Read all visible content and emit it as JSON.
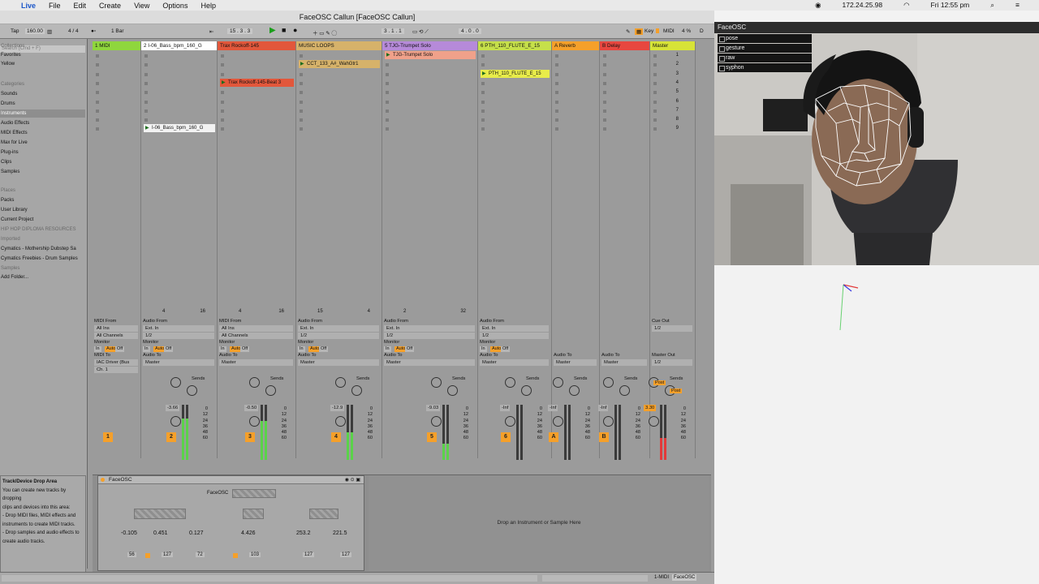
{
  "menubar": {
    "items": [
      "Live",
      "File",
      "Edit",
      "Create",
      "View",
      "Options",
      "Help"
    ],
    "ip": "172.24.25.98",
    "clock": "Fri 12:55 pm"
  },
  "live": {
    "title": "FaceOSC Callun  [FaceOSC Callun]",
    "transport": {
      "tap": "Tap",
      "tempo": "160.00",
      "sig": "4 / 4",
      "quant": "1 Bar",
      "pos": "15 .  3 .  3",
      "loop_start": "3 .  1 .  1",
      "loop_len": "4 .  0 .  0",
      "key": "Key",
      "midi": "MIDI",
      "cpu": "4 %",
      "d": "D"
    },
    "browser": {
      "search": "Search (Cmd + F)",
      "items": [
        {
          "label": "Collections",
          "hdr": true
        },
        {
          "label": "Favorites"
        },
        {
          "label": "Yellow"
        },
        {
          "label": "Categories",
          "hdr": true
        },
        {
          "label": "Sounds"
        },
        {
          "label": "Drums"
        },
        {
          "label": "Instruments",
          "sel": true
        },
        {
          "label": "Audio Effects"
        },
        {
          "label": "MIDI Effects"
        },
        {
          "label": "Max for Live"
        },
        {
          "label": "Plug-ins"
        },
        {
          "label": "Clips"
        },
        {
          "label": "Samples"
        },
        {
          "label": "Places",
          "hdr": true
        },
        {
          "label": "Packs"
        },
        {
          "label": "User Library"
        },
        {
          "label": "Current Project"
        },
        {
          "label": "HIP HOP DIPLOMA RESOURCES",
          "hdr": true
        },
        {
          "label": "Imported",
          "hdr": true
        },
        {
          "label": "Cymatics - Mothership Dubstep Sa"
        },
        {
          "label": "Cymatics Freebies - Drum Samples"
        },
        {
          "label": "Samples",
          "hdr": true
        },
        {
          "label": "Add Folder..."
        }
      ],
      "help_title": "Track/Device Drop Area",
      "help_lines": [
        "You can create new tracks by dropping",
        "clips and devices into this area:",
        "- Drop MIDI files, MIDI effects and",
        "instruments to create MIDI tracks.",
        "- Drop samples and audio effects to",
        "create audio tracks."
      ]
    },
    "tracks": [
      {
        "name": "1 MIDI",
        "color": "#8fd63d",
        "num": "1",
        "from": "MIDI From",
        "fromval": "All Ins",
        "ch": "All Channels",
        "to": "MIDI To",
        "toval": "IAC Driver (Bus",
        "toch": "Ch. 1",
        "vol": "",
        "meter": 0
      },
      {
        "name": "2 I-06_Bass_bpm_160_G",
        "color": "#ffffff",
        "num": "2",
        "from": "Audio From",
        "fromval": "Ext. In",
        "ch": "1/2",
        "to": "Audio To",
        "toval": "Master",
        "toch": "",
        "vol": "-3.66",
        "meter": 0.75
      },
      {
        "name": "Trax Rockoff-145",
        "color": "#e2573b",
        "num": "3",
        "from": "MIDI From",
        "fromval": "All Ins",
        "ch": "All Channels",
        "to": "Audio To",
        "toval": "Master",
        "toch": "",
        "vol": "-0.50",
        "meter": 0.7
      },
      {
        "name": "MUSIC LOOPS",
        "color": "#d6b26a",
        "num": "4",
        "from": "Audio From",
        "fromval": "Ext. In",
        "ch": "1/2",
        "to": "Audio To",
        "toval": "Master",
        "toch": "",
        "vol": "-12.9",
        "meter": 0.5
      },
      {
        "name": "5 TJG-Trumpet Solo",
        "color": "#b68ad9",
        "num": "5",
        "from": "Audio From",
        "fromval": "Ext. In",
        "ch": "1/2",
        "to": "Audio To",
        "toval": "Master",
        "toch": "",
        "vol": "-9.03",
        "meter": 0.3
      },
      {
        "name": "6 PTH_110_FLUTE_E_15",
        "color": "#c6e04a",
        "num": "6",
        "from": "Audio From",
        "fromval": "Ext. In",
        "ch": "1/2",
        "to": "Audio To",
        "toval": "Master",
        "toch": "",
        "vol": "-Inf",
        "meter": 0
      },
      {
        "name": "A Reverb",
        "color": "#f5a02a",
        "num": "A",
        "from": "",
        "fromval": "",
        "ch": "",
        "to": "Audio To",
        "toval": "Master",
        "toch": "",
        "vol": "-Inf",
        "meter": 0
      },
      {
        "name": "B Delay",
        "color": "#e8473f",
        "num": "B",
        "from": "",
        "fromval": "",
        "ch": "",
        "to": "Audio To",
        "toval": "Master",
        "toch": "",
        "vol": "-Inf",
        "meter": 0
      },
      {
        "name": "Master",
        "color": "#d7e337",
        "num": "",
        "from": "Cue Out",
        "fromval": "1/2",
        "ch": "",
        "to": "Master Out",
        "toval": "1/2",
        "toch": "",
        "vol": "3.30",
        "meter": 0.4
      }
    ],
    "clips": [
      {
        "track": 1,
        "row": 8,
        "label": "I-06_Bass_bpm_160_G",
        "color": "#f2f2f2"
      },
      {
        "track": 2,
        "row": 3,
        "label": "Trax Rockoff-145-Beat 3",
        "color": "#e2573b"
      },
      {
        "track": 3,
        "row": 1,
        "label": "CCT_133_A#_WahGtr1",
        "color": "#d6b26a"
      },
      {
        "track": 4,
        "row": 0,
        "label": "TJG-Trumpet Solo",
        "color": "#f0a18a"
      },
      {
        "track": 5,
        "row": 2,
        "label": "PTH_110_FLUTE_E_15",
        "color": "#e8ec4a"
      }
    ],
    "scenes": [
      "1",
      "2",
      "3",
      "4",
      "5",
      "6",
      "7",
      "8",
      "9"
    ],
    "clipstats": [
      {
        "a": "4",
        "b": "16"
      },
      {
        "a": "4",
        "b": "16"
      },
      {
        "a": "15",
        "b": "4"
      },
      {
        "a": "2",
        "b": "32"
      }
    ],
    "sends_label": "Sends",
    "monitor": {
      "label": "Monitor",
      "in": "In",
      "auto": "Auto",
      "off": "Off"
    },
    "post": "Post",
    "scale": [
      "0",
      "12",
      "24",
      "36",
      "48",
      "60"
    ],
    "device": {
      "name": "FaceOSC",
      "inner": "FaceOSC",
      "values": [
        "-0.105",
        "0.451",
        "0.127",
        "4.426",
        "253.2",
        "221.5"
      ],
      "nums": [
        "56",
        "127",
        "72",
        "103",
        "127",
        "127"
      ],
      "drop_hint": "Drop an Instrument or Sample Here"
    },
    "status": {
      "track": "1-MIDI",
      "device": "FaceOSC"
    }
  },
  "faceosc": {
    "title": "FaceOSC",
    "menu": [
      "pose",
      "gesture",
      "raw",
      "syphon"
    ]
  }
}
